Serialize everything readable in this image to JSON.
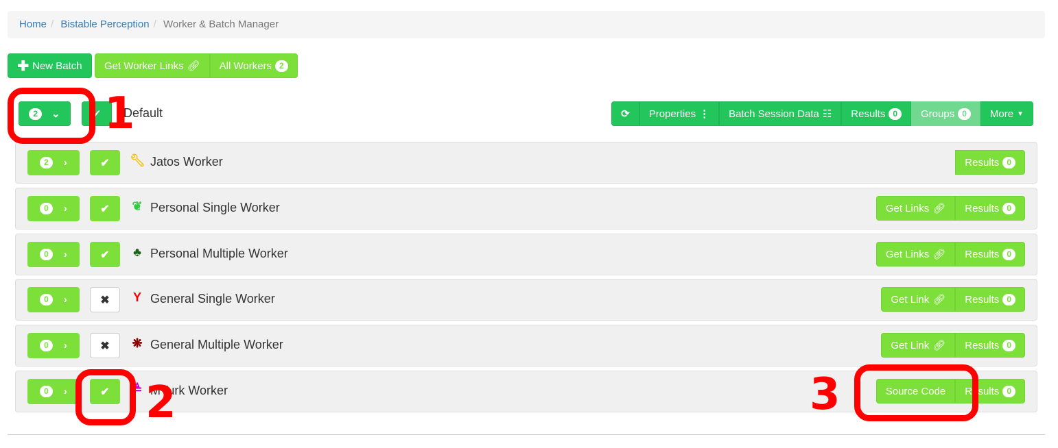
{
  "breadcrumb": [
    "Home",
    "Bistable Perception",
    "Worker & Batch Manager"
  ],
  "toolbar": {
    "new_batch": "New Batch",
    "get_worker_links": "Get Worker Links",
    "all_workers": "All Workers",
    "all_workers_count": "2"
  },
  "batch": {
    "count": "2",
    "name": "Default",
    "properties": "Properties",
    "session_data": "Batch Session Data",
    "results": "Results",
    "results_count": "0",
    "groups": "Groups",
    "groups_count": "0",
    "more": "More"
  },
  "workers": [
    {
      "count": "2",
      "enabled": true,
      "icon": "wrench-icon",
      "name": "Jatos Worker",
      "links": "",
      "results": "Results",
      "results_count": "0"
    },
    {
      "count": "0",
      "enabled": true,
      "icon": "leaf-icon",
      "name": "Personal Single Worker",
      "links": "Get Links",
      "results": "Results",
      "results_count": "0"
    },
    {
      "count": "0",
      "enabled": true,
      "icon": "tree-icon",
      "name": "Personal Multiple Worker",
      "links": "Get Links",
      "results": "Results",
      "results_count": "0"
    },
    {
      "count": "0",
      "enabled": false,
      "icon": "glass-icon",
      "name": "General Single Worker",
      "links": "Get Link",
      "results": "Results",
      "results_count": "0"
    },
    {
      "count": "0",
      "enabled": false,
      "icon": "asterisk-icon",
      "name": "General Multiple Worker",
      "links": "Get Link",
      "results": "Results",
      "results_count": "0"
    },
    {
      "count": "0",
      "enabled": true,
      "icon": "mturk-icon",
      "name": "MTurk Worker",
      "links": "Source Code",
      "results": "Results",
      "results_count": "0"
    }
  ],
  "annotations": [
    "1",
    "2",
    "3"
  ],
  "colors": {
    "dark_green": "#22c65b",
    "light_green": "#7ddf3a",
    "pale_green": "#70d98f",
    "highlight": "#ff0000"
  }
}
